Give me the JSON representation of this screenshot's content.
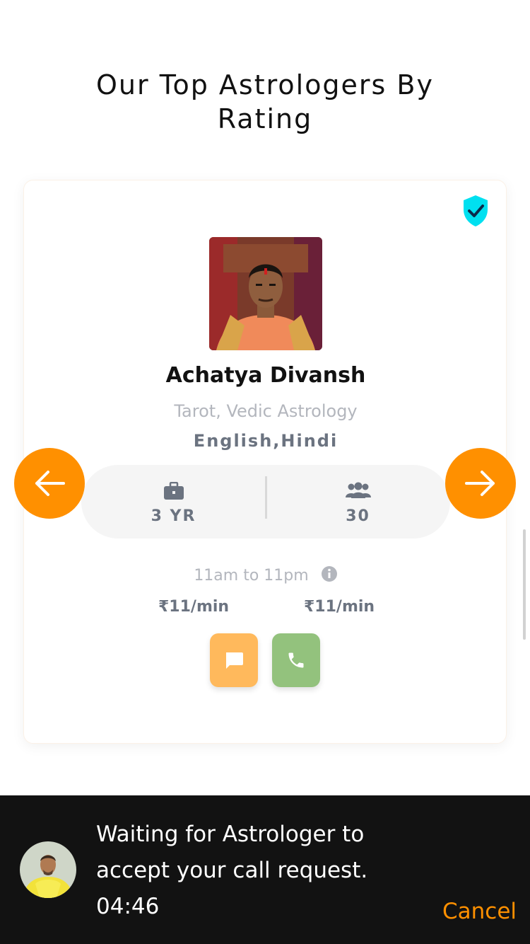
{
  "section": {
    "title_line1": "Our Top Astrologers By",
    "title_line2": "Rating"
  },
  "astrologer": {
    "name": "Achatya Divansh",
    "skills": "Tarot, Vedic Astrology",
    "languages": "English,Hindi",
    "experience": "3 YR",
    "followers": "30",
    "hours": "11am to 11pm",
    "chat_price": "₹11/min",
    "call_price": "₹11/min",
    "verified_icon": "verified-shield-icon",
    "photo": "astrologer-photo"
  },
  "banner": {
    "message": "Waiting for Astrologer to accept your call request.",
    "timer": "04:46",
    "cancel_label": "Cancel",
    "avatar": "astrologer-avatar"
  },
  "colors": {
    "accent": "#ff9000",
    "verified": "#00e0f0",
    "chat_button": "#ffb95c",
    "call_button": "#93c27d",
    "banner_bg": "#121212"
  }
}
